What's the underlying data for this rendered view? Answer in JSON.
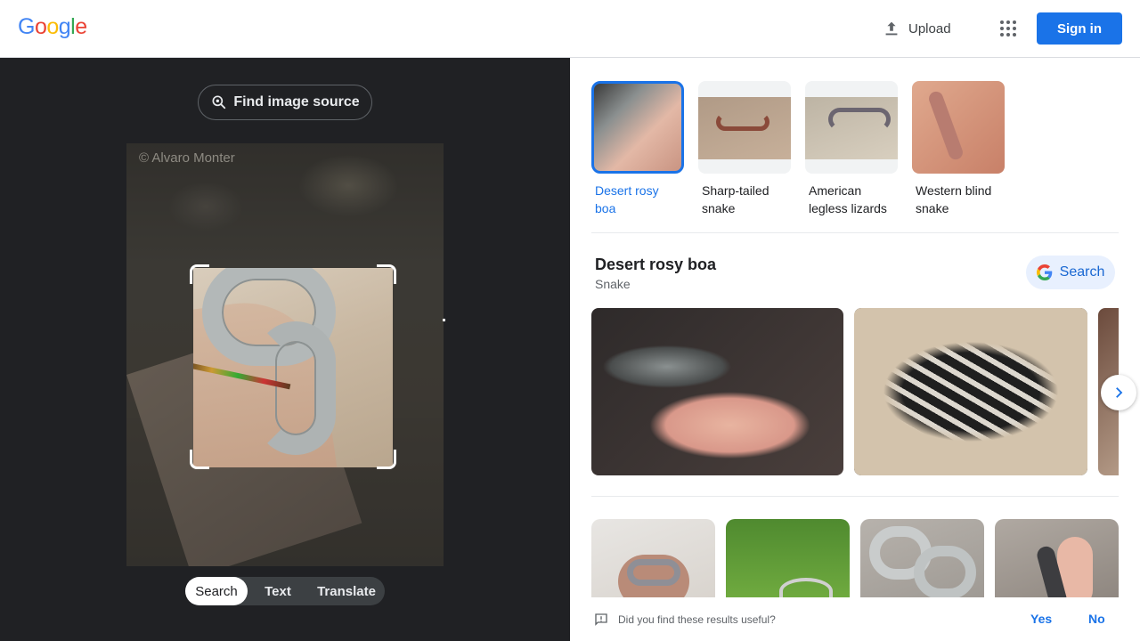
{
  "header": {
    "logo": [
      "G",
      "o",
      "o",
      "g",
      "l",
      "e"
    ],
    "logo_colors": [
      "#4285F4",
      "#EA4335",
      "#FBBC05",
      "#4285F4",
      "#34A853",
      "#EA4335"
    ],
    "upload_label": "Upload",
    "signin_label": "Sign in"
  },
  "left": {
    "find_source_label": "Find image source",
    "watermark": "© Alvaro Monter",
    "modes": [
      "Search",
      "Text",
      "Translate"
    ],
    "active_mode": "Search"
  },
  "right": {
    "chips": [
      {
        "line1": "Desert rosy",
        "line2": "boa",
        "selected": true
      },
      {
        "line1": "Sharp-tailed",
        "line2": "snake",
        "selected": false
      },
      {
        "line1": "American",
        "line2": "legless lizards",
        "selected": false
      },
      {
        "line1": "Western blind",
        "line2": "snake",
        "selected": false
      }
    ],
    "kg": {
      "title": "Desert rosy boa",
      "subtitle": "Snake",
      "search_label": "Search"
    },
    "feedback": {
      "question": "Did you find these results useful?",
      "yes": "Yes",
      "no": "No"
    }
  },
  "colors": {
    "accent": "#1a73e8",
    "left_bg": "#202124"
  }
}
